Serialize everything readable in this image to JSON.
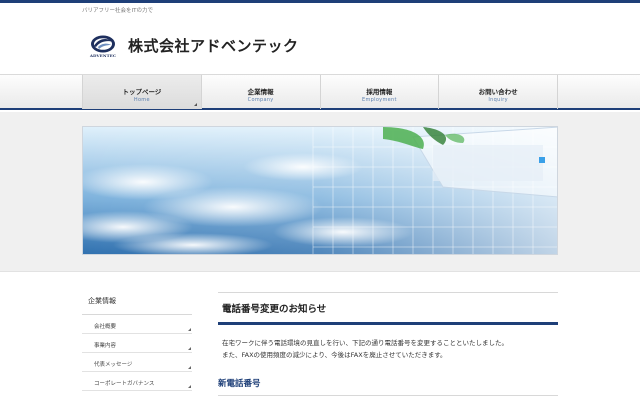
{
  "header": {
    "tagline": "バリアフリー社会をITの力で",
    "logo_text": "株式会社アドベンテック",
    "logo_sub": "ADVENTEC"
  },
  "nav": {
    "items": [
      {
        "jp": "トップページ",
        "en": "Home"
      },
      {
        "jp": "企業情報",
        "en": "Company"
      },
      {
        "jp": "採用情報",
        "en": "Employment"
      },
      {
        "jp": "お問い合わせ",
        "en": "Inquiry"
      }
    ]
  },
  "colors": {
    "brand_navy": "#1e3f78",
    "nav_en": "#5b7fae"
  },
  "sidebar": {
    "title": "企業情報",
    "items": [
      {
        "label": "会社概要"
      },
      {
        "label": "事業内容"
      },
      {
        "label": "代表メッセージ"
      },
      {
        "label": "コーポレートガバナンス"
      }
    ]
  },
  "main": {
    "title": "電話番号変更のお知らせ",
    "paragraph_line1": "在宅ワークに伴う電話環境の見直しを行い、下記の通り電話番号を変更することといたしました。",
    "paragraph_line2": "また、FAXの使用頻度の減少により、今後はFAXを廃止させていただきます。",
    "subtitle": "新電話番号"
  }
}
